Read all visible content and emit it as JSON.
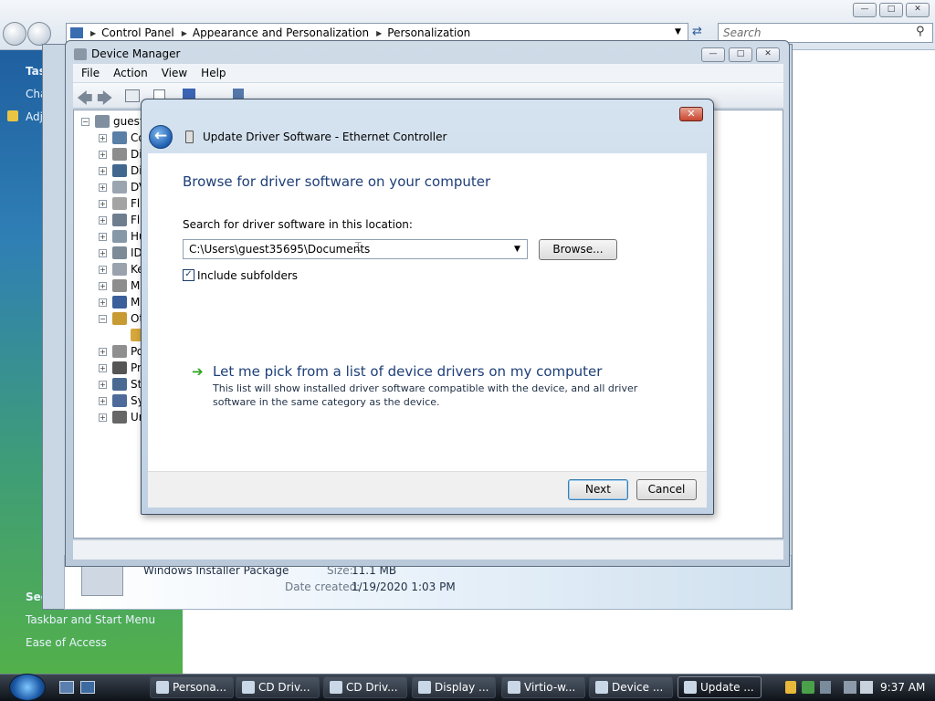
{
  "control_panel": {
    "address": [
      "Control Panel",
      "Appearance and Personalization",
      "Personalization"
    ],
    "search_placeholder": "Search",
    "left_links_top": [
      "Tas",
      "Cha",
      "Adj"
    ],
    "left_links_bottom": [
      "See also",
      "Taskbar and Start Menu",
      "Ease of Access"
    ]
  },
  "device_manager": {
    "title": "Device Manager",
    "menu": [
      "File",
      "Action",
      "View",
      "Help"
    ],
    "tree_root": "guest",
    "tree_items": [
      "Co",
      "Di",
      "Di",
      "DV",
      "Fl",
      "Fl",
      "Hu",
      "ID",
      "Ke",
      "M",
      "M",
      "Ot",
      "",
      "Po",
      "Pr",
      "St",
      "Sy",
      "Ur"
    ]
  },
  "dialog": {
    "title": "Update Driver Software - Ethernet Controller",
    "heading": "Browse for driver software on your computer",
    "search_label": "Search for driver software in this location:",
    "path_value": "C:\\Users\\guest35695\\Documents",
    "browse_label": "Browse...",
    "include_subfolders": "Include subfolders",
    "pick_link": "Let me pick from a list of device drivers on my computer",
    "pick_desc": "This list will show installed driver software compatible with the device, and all driver software in the same category as the device.",
    "next_label": "Next",
    "cancel_label": "Cancel"
  },
  "details": {
    "type": "Windows Installer Package",
    "size_label": "Size:",
    "size_value": "11.1 MB",
    "created_label": "Date created:",
    "created_value": "1/19/2020 1:03 PM"
  },
  "taskbar": {
    "items": [
      "Persona...",
      "CD Driv...",
      "CD Driv...",
      "Display ...",
      "Virtio-w...",
      "Device ...",
      "Update ..."
    ],
    "clock": "9:37 AM"
  },
  "colors": {
    "accent": "#1e3f78",
    "link_arrow": "#2fa321"
  }
}
